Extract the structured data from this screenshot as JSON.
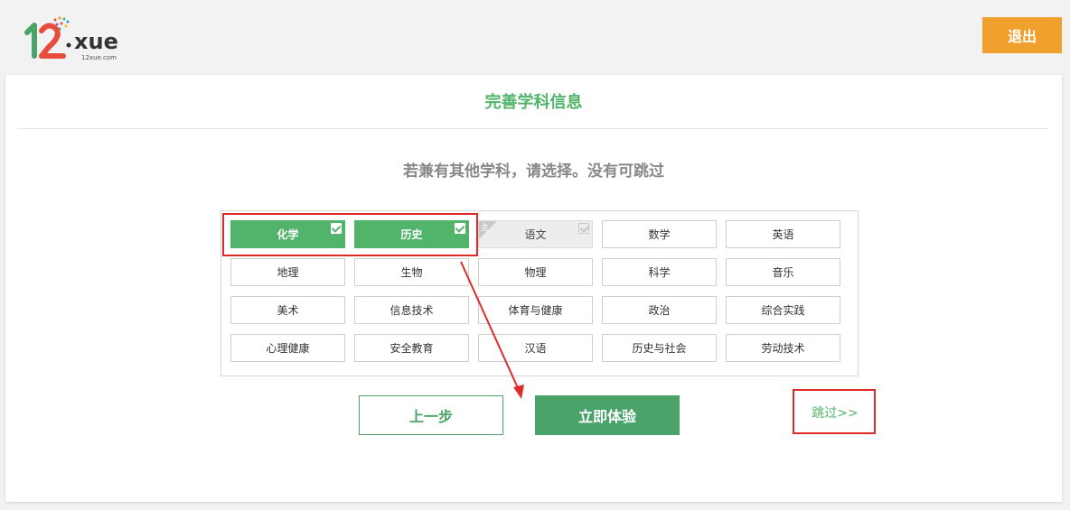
{
  "header": {
    "logout_label": "退出",
    "logo_sub": "12xue.com"
  },
  "card": {
    "title": "完善学科信息",
    "subtitle": "若兼有其他学科，请选择。没有可跳过"
  },
  "subjects": [
    {
      "label": "化学",
      "state": "selected"
    },
    {
      "label": "历史",
      "state": "selected"
    },
    {
      "label": "语文",
      "state": "main",
      "badge": "主"
    },
    {
      "label": "数学",
      "state": "normal"
    },
    {
      "label": "英语",
      "state": "normal"
    },
    {
      "label": "地理",
      "state": "normal"
    },
    {
      "label": "生物",
      "state": "normal"
    },
    {
      "label": "物理",
      "state": "normal"
    },
    {
      "label": "科学",
      "state": "normal"
    },
    {
      "label": "音乐",
      "state": "normal"
    },
    {
      "label": "美术",
      "state": "normal"
    },
    {
      "label": "信息技术",
      "state": "normal"
    },
    {
      "label": "体育与健康",
      "state": "normal"
    },
    {
      "label": "政治",
      "state": "normal"
    },
    {
      "label": "综合实践",
      "state": "normal"
    },
    {
      "label": "心理健康",
      "state": "normal"
    },
    {
      "label": "安全教育",
      "state": "normal"
    },
    {
      "label": "汉语",
      "state": "normal"
    },
    {
      "label": "历史与社会",
      "state": "normal"
    },
    {
      "label": "劳动技术",
      "state": "normal"
    }
  ],
  "actions": {
    "prev_label": "上一步",
    "go_label": "立即体验",
    "skip_label": "跳过>>"
  },
  "colors": {
    "accent_green": "#52b46a",
    "button_green": "#4aa46a",
    "logout_orange": "#f0a02c",
    "annotation_red": "#e02a2a"
  }
}
